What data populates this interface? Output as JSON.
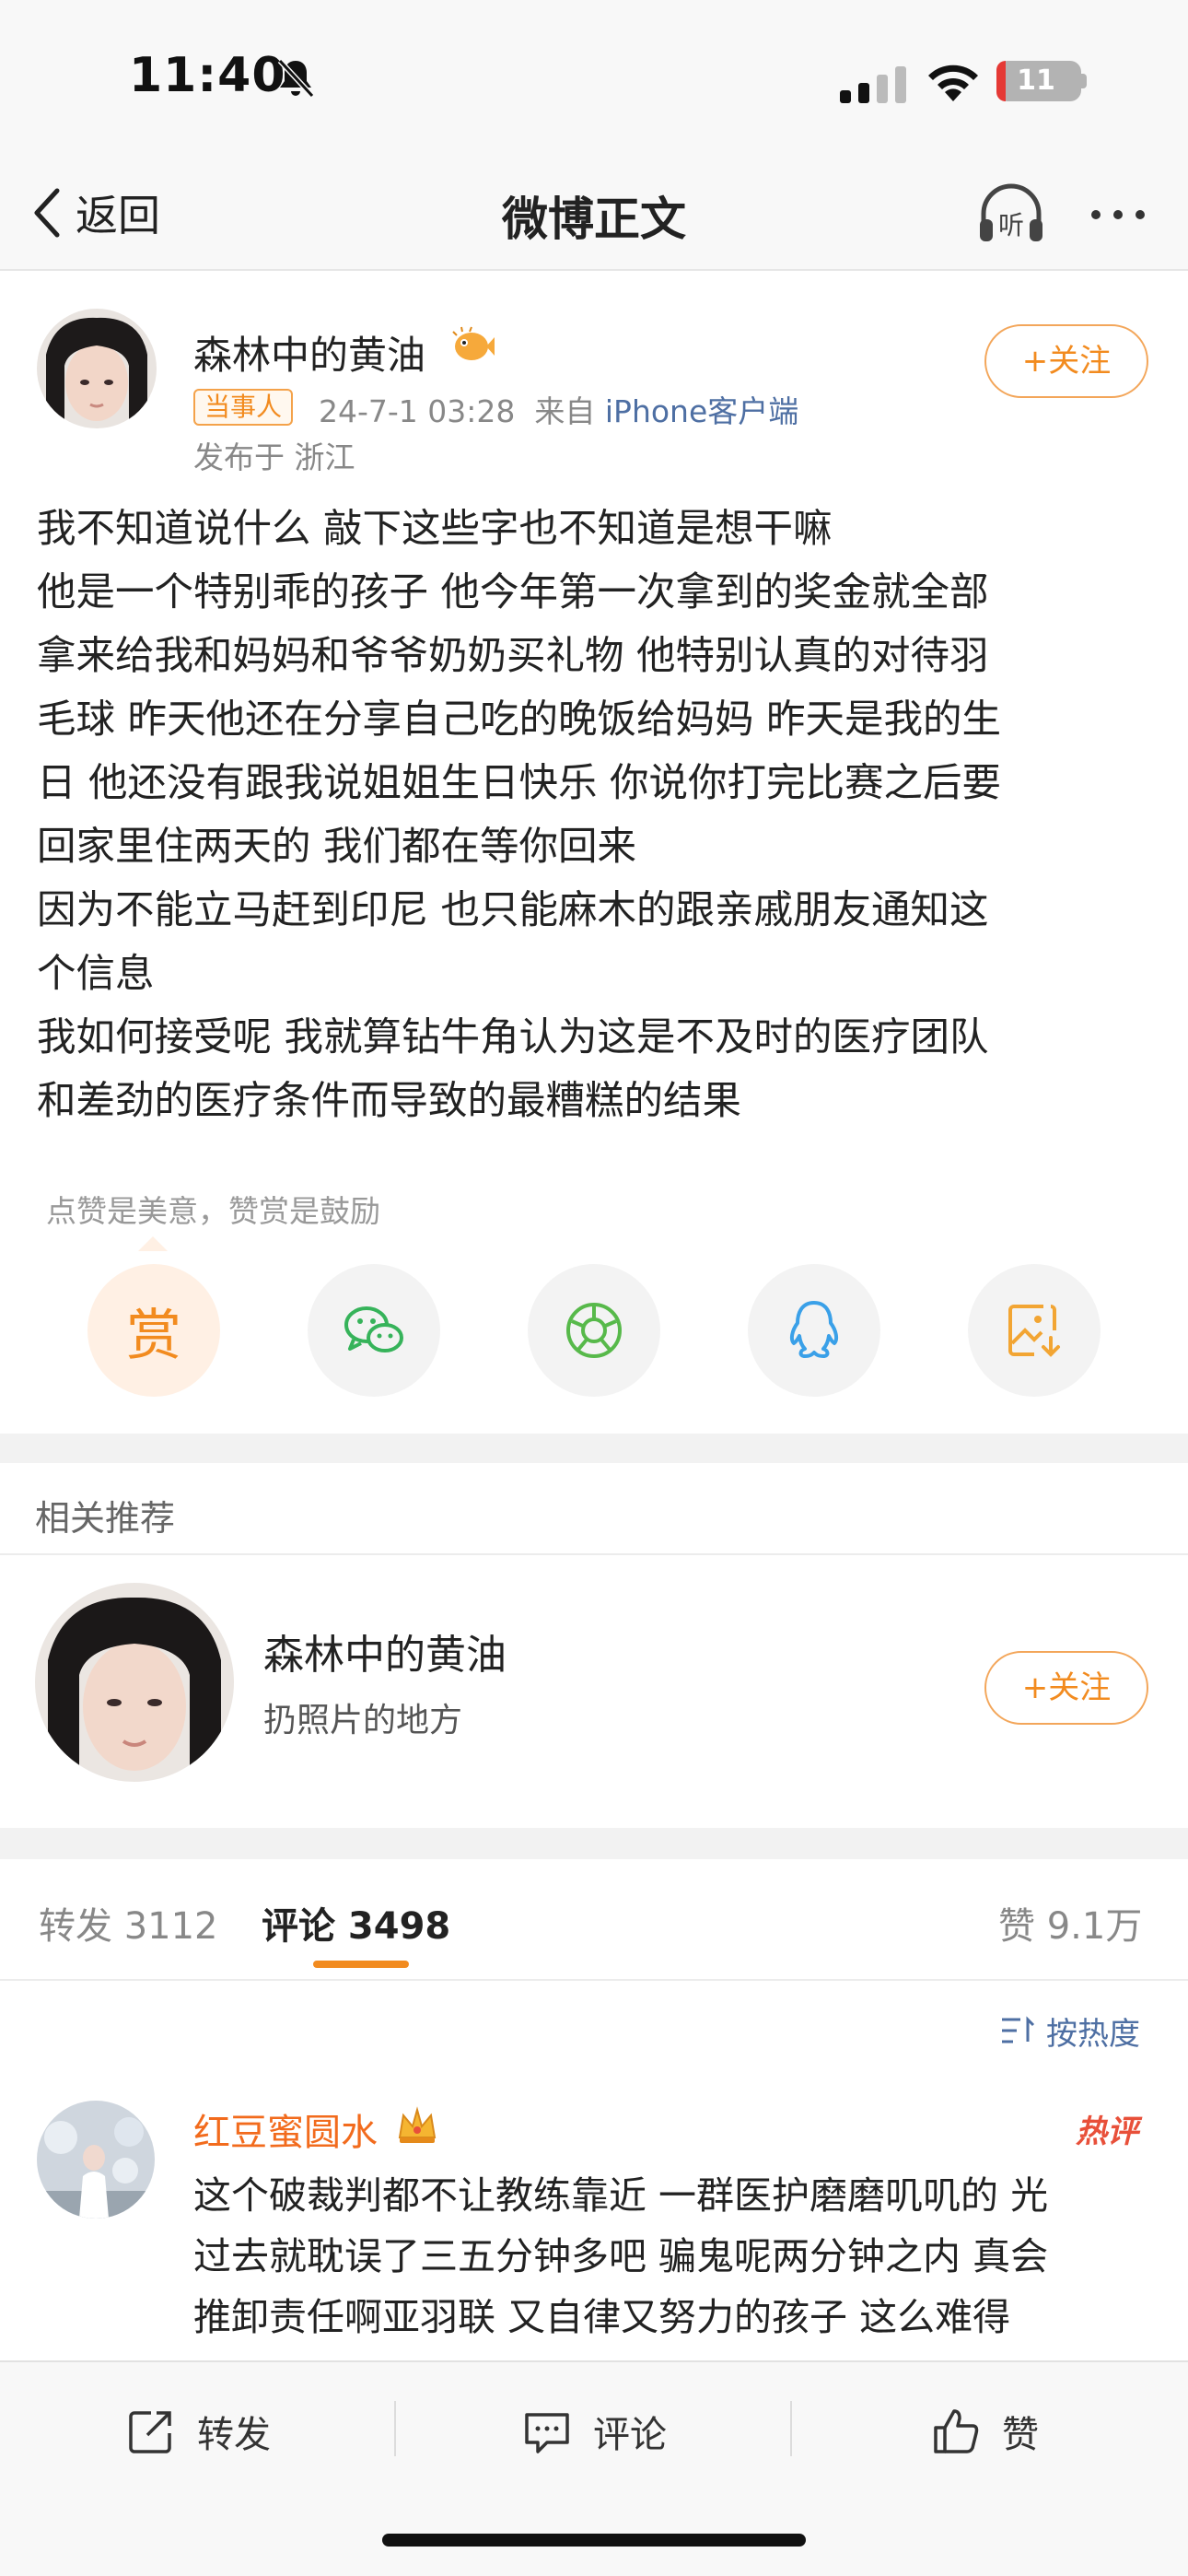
{
  "status_bar": {
    "time": "11:40",
    "battery_level": "11",
    "battery_fraction": 0.11
  },
  "nav": {
    "back_label": "返回",
    "title": "微博正文",
    "listen_icon_text": "听"
  },
  "author": {
    "name": "森林中的黄油",
    "tag": "当事人",
    "time": "24-7-1 03:28",
    "source_prefix": "来自",
    "source": "iPhone客户端",
    "location": "发布于 浙江",
    "follow_label": "+关注"
  },
  "post": {
    "lines": [
      "我不知道说什么 敲下这些字也不知道是想干嘛",
      "他是一个特别乖的孩子 他今年第一次拿到的奖金就全部",
      "拿来给我和妈妈和爷爷奶奶买礼物 他特别认真的对待羽",
      "毛球 昨天他还在分享自己吃的晚饭给妈妈 昨天是我的生",
      "日 他还没有跟我说姐姐生日快乐 你说你打完比赛之后要",
      "回家里住两天的 我们都在等你回来",
      "因为不能立马赶到印尼 也只能麻木的跟亲戚朋友通知这",
      "个信息",
      "我如何接受呢 我就算钻牛角认为这是不及时的医疗团队",
      "和差劲的医疗条件而导致的最糟糕的结果"
    ]
  },
  "reward": {
    "hint": "点赞是美意，赞赏是鼓励",
    "button_glyph": "赏"
  },
  "share_buttons": [
    "wechat-icon",
    "moments-icon",
    "qq-icon",
    "save-image-icon"
  ],
  "related": {
    "section_title": "相关推荐",
    "name": "森林中的黄油",
    "desc": "扔照片的地方",
    "follow_label": "+关注"
  },
  "tabs": {
    "repost": "转发 3112",
    "comment": "评论 3498",
    "like": "赞 9.1万"
  },
  "sort": {
    "label": "按热度"
  },
  "comment": {
    "user": "红豆蜜圆水",
    "badge": "热评",
    "lines": [
      "这个破裁判都不让教练靠近 一群医护磨磨叽叽的 光",
      "过去就耽误了三五分钟多吧 骗鬼呢两分钟之内 真会",
      "推卸责任啊亚羽联 又自律又努力的孩子 这么难得"
    ]
  },
  "bottom_bar": {
    "repost": "转发",
    "comment": "评论",
    "like": "赞"
  },
  "colors": {
    "accent": "#f28b1f",
    "link": "#4e6fa3",
    "hot": "#e8503a"
  }
}
